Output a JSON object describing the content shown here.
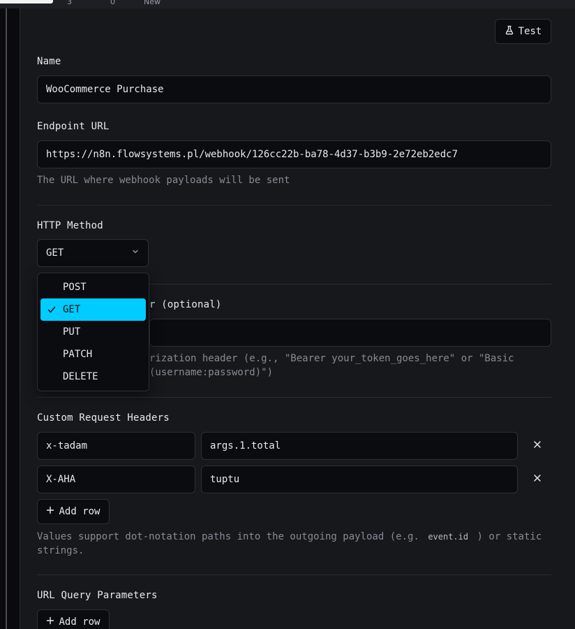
{
  "colors": {
    "accent": "#00ccff",
    "background": "#17181c",
    "input_bg": "#0b0c10"
  },
  "topbar": {
    "ghost_a": "3",
    "ghost_b": "0",
    "ghost_c": "New"
  },
  "header": {
    "test_label": "Test",
    "test_icon": "flask-icon"
  },
  "name": {
    "label": "Name",
    "value": "WooCommerce Purchase"
  },
  "endpoint": {
    "label": "Endpoint URL",
    "value": "https://n8n.flowsystems.pl/webhook/126cc22b-ba78-4d37-b3b9-2e72eb2edc7",
    "help": "The URL where webhook payloads will be sent"
  },
  "method": {
    "label": "HTTP Method",
    "selected": "GET",
    "options": [
      "POST",
      "GET",
      "PUT",
      "PATCH",
      "DELETE"
    ]
  },
  "auth": {
    "label_visible": "r (optional)",
    "help_line1_visible": "rization header (e.g., \"Bearer your_token_goes_here\" or \"Basic",
    "help_line2_visible": "(username:password)\")"
  },
  "custom_headers": {
    "label": "Custom Request Headers",
    "rows": [
      {
        "key": "x-tadam",
        "value": "args.1.total"
      },
      {
        "key": "X-AHA",
        "value": "tuptu"
      }
    ],
    "add_row": "Add row",
    "help_pre": "Values support dot-notation paths into the outgoing payload (e.g.",
    "help_code": "event.id",
    "help_post": ") or static",
    "help_line2": "strings."
  },
  "query_params": {
    "label": "URL Query Parameters",
    "add_row": "Add row"
  }
}
